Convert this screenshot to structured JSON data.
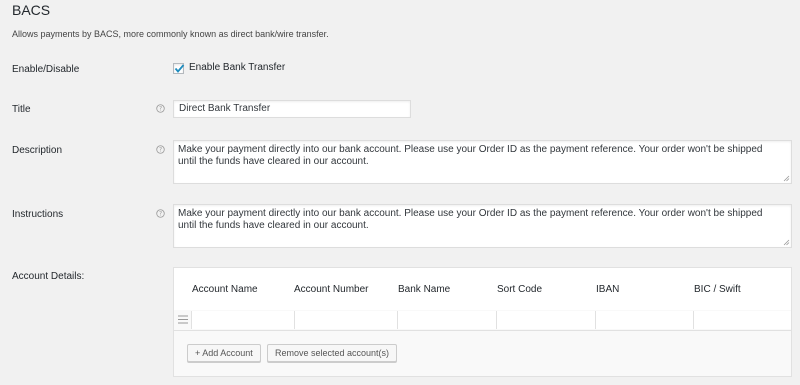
{
  "section": {
    "title": "BACS",
    "subtitle": "Allows payments by BACS, more commonly known as direct bank/wire transfer."
  },
  "enable": {
    "label": "Enable/Disable",
    "checkbox_label": "Enable Bank Transfer",
    "checked": true
  },
  "title_field": {
    "label": "Title",
    "value": "Direct Bank Transfer"
  },
  "description": {
    "label": "Description",
    "line1": "Make your payment directly into our bank account. Please use your Order ID as the payment reference. Your order won't be shipped",
    "line2": "until the funds have cleared in our account."
  },
  "instructions": {
    "label": "Instructions",
    "line1": "Make your payment directly into our bank account. Please use your Order ID as the payment reference. Your order won't be shipped",
    "line2": "until the funds have cleared in our account."
  },
  "accounts": {
    "label": "Account Details:",
    "columns": [
      "Account Name",
      "Account Number",
      "Bank Name",
      "Sort Code",
      "IBAN",
      "BIC / Swift"
    ],
    "add_button": "+ Add Account",
    "remove_button": "Remove selected account(s)"
  },
  "icons": {
    "help": "help-icon",
    "check": "checkmark-icon",
    "drag": "drag-handle-icon",
    "resize": "resize-grip-icon"
  },
  "colors": {
    "background": "#f1f1f1",
    "check": "#1e8cbe",
    "border": "#dddddd"
  }
}
